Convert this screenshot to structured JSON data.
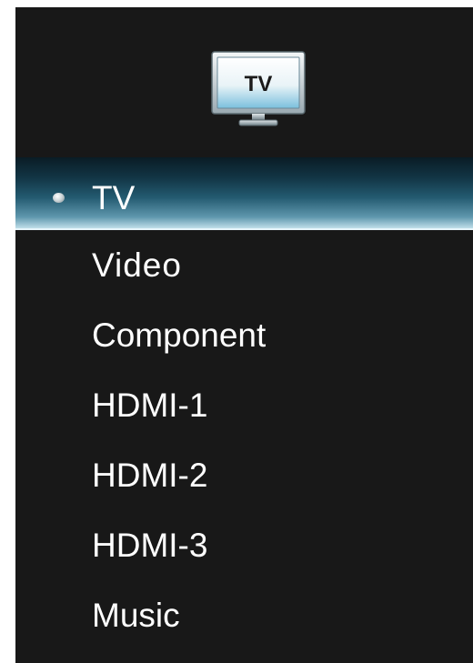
{
  "header": {
    "icon": "tv-icon",
    "icon_label": "TV"
  },
  "menu": {
    "items": [
      {
        "label": "TV",
        "selected": true
      },
      {
        "label": "Video",
        "selected": false
      },
      {
        "label": "Component",
        "selected": false
      },
      {
        "label": "HDMI-1",
        "selected": false
      },
      {
        "label": "HDMI-2",
        "selected": false
      },
      {
        "label": "HDMI-3",
        "selected": false
      },
      {
        "label": "Music",
        "selected": false
      }
    ]
  },
  "colors": {
    "background": "#181818",
    "text": "#ffffff",
    "highlight": "#5f97ad"
  }
}
